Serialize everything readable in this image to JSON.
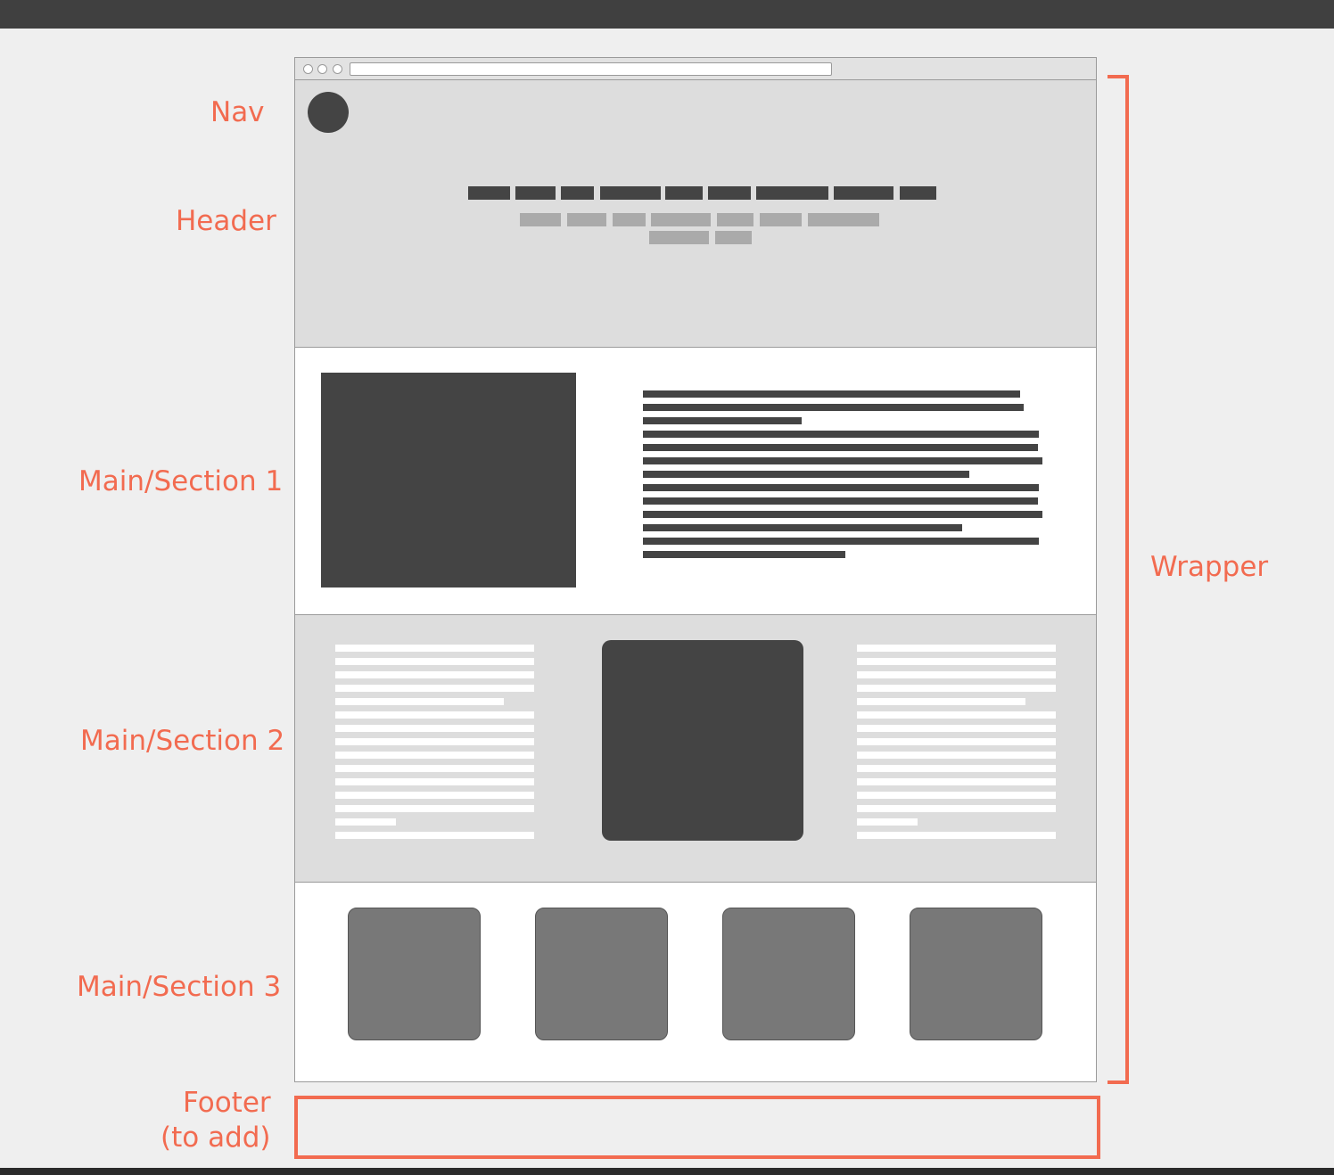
{
  "labels": {
    "nav": "Nav",
    "header": "Header",
    "section1": "Main/Section 1",
    "section2": "Main/Section 2",
    "section3": "Main/Section 3",
    "wrapper": "Wrapper",
    "footer_line1": "Footer",
    "footer_line2": "(to add)"
  },
  "colors": {
    "annotation": "#f26b50",
    "placeholder_dark": "#444444",
    "placeholder_tile": "#787878",
    "section_gray": "#dddddd",
    "section_white": "#ffffff",
    "canvas": "#efefef"
  },
  "icons": {
    "logo": "circle-logo-placeholder",
    "browser_buttons": "window-dots"
  },
  "placeholders": {
    "section1_text_lines": 13,
    "section2_text_lines_per_column": 15,
    "section3_tiles": 4
  }
}
